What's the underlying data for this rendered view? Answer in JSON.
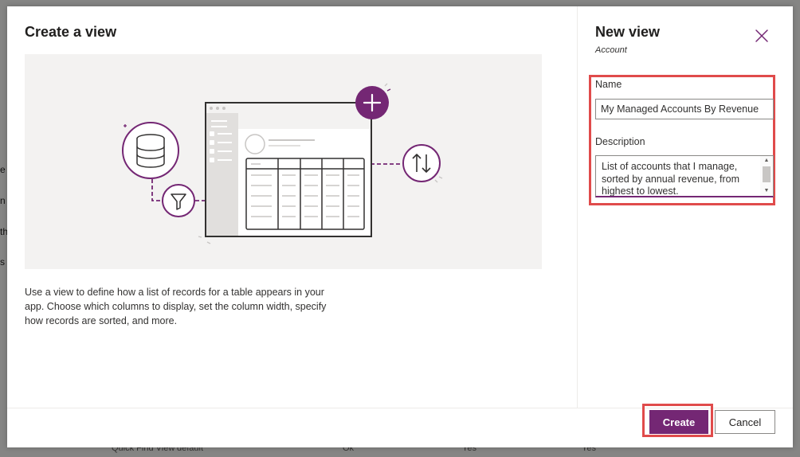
{
  "background": {
    "left_fragments": [
      "e V",
      "n",
      "th",
      "s"
    ],
    "bottom_row": [
      "Quick Find View",
      "default",
      "Ok",
      "Yes",
      "Yes"
    ]
  },
  "main": {
    "title": "Create a view",
    "description": "Use a view to define how a list of records for a table appears in your app. Choose which columns to display, set the column width, specify how records are sorted, and more."
  },
  "panel": {
    "title": "New view",
    "subtitle": "Account",
    "close_icon": "close-icon",
    "name_label": "Name",
    "name_value": "My Managed Accounts By Revenue",
    "description_label": "Description",
    "description_value": "List of accounts that I manage, sorted by annual revenue, from highest to lowest."
  },
  "footer": {
    "create_label": "Create",
    "cancel_label": "Cancel"
  },
  "colors": {
    "accent": "#742774",
    "highlight": "#e04b4b"
  }
}
